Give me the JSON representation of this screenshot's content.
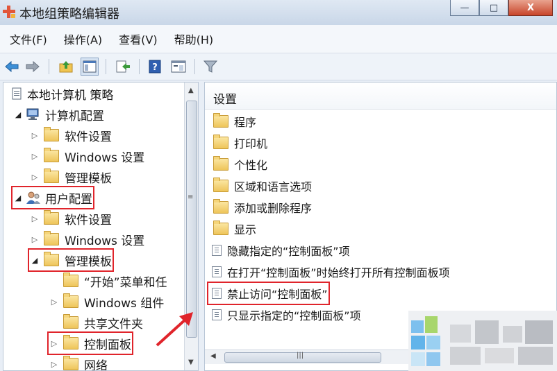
{
  "window": {
    "title": "本地组策略编辑器",
    "buttons": {
      "minimize": "—",
      "maximize": "□",
      "close": "X"
    }
  },
  "menu": [
    {
      "label": "文件(F)"
    },
    {
      "label": "操作(A)"
    },
    {
      "label": "查看(V)"
    },
    {
      "label": "帮助(H)"
    }
  ],
  "toolbar": [
    {
      "icon": "back-arrow-icon"
    },
    {
      "icon": "forward-arrow-icon"
    },
    {
      "icon": "up-folder-icon"
    },
    {
      "icon": "show-hide-tree-icon"
    },
    {
      "icon": "export-list-icon"
    },
    {
      "icon": "help-icon"
    },
    {
      "icon": "properties-icon"
    },
    {
      "icon": "filter-icon"
    }
  ],
  "tree": [
    {
      "label": "本地计算机 策略",
      "icon": "policy-doc-icon",
      "indent": 0,
      "expand": ""
    },
    {
      "label": "计算机配置",
      "icon": "computer-icon",
      "indent": 1,
      "expand": "open"
    },
    {
      "label": "软件设置",
      "icon": "folder-icon",
      "indent": 2,
      "expand": "closed"
    },
    {
      "label": "Windows 设置",
      "icon": "folder-icon",
      "indent": 2,
      "expand": "closed"
    },
    {
      "label": "管理模板",
      "icon": "folder-icon",
      "indent": 2,
      "expand": "closed"
    },
    {
      "label": "用户配置",
      "icon": "user-icon",
      "indent": 1,
      "expand": "open",
      "highlight": true
    },
    {
      "label": "软件设置",
      "icon": "folder-icon",
      "indent": 2,
      "expand": "closed"
    },
    {
      "label": "Windows 设置",
      "icon": "folder-icon",
      "indent": 2,
      "expand": "closed"
    },
    {
      "label": "管理模板",
      "icon": "folder-icon",
      "indent": 2,
      "expand": "open",
      "highlight": true
    },
    {
      "label": "“开始”菜单和任",
      "icon": "folder-icon",
      "indent": 3,
      "expand": ""
    },
    {
      "label": "Windows 组件",
      "icon": "folder-icon",
      "indent": 3,
      "expand": "closed"
    },
    {
      "label": "共享文件夹",
      "icon": "folder-icon",
      "indent": 3,
      "expand": ""
    },
    {
      "label": "控制面板",
      "icon": "folder-icon",
      "indent": 3,
      "expand": "closed",
      "highlight": true
    },
    {
      "label": "网络",
      "icon": "folder-icon",
      "indent": 3,
      "expand": "closed"
    }
  ],
  "settings": {
    "header": "设置",
    "items": [
      {
        "label": "程序",
        "type": "folder"
      },
      {
        "label": "打印机",
        "type": "folder"
      },
      {
        "label": "个性化",
        "type": "folder"
      },
      {
        "label": "区域和语言选项",
        "type": "folder"
      },
      {
        "label": "添加或删除程序",
        "type": "folder"
      },
      {
        "label": "显示",
        "type": "folder"
      },
      {
        "label": "隐藏指定的“控制面板”项",
        "type": "setting"
      },
      {
        "label": "在打开“控制面板”时始终打开所有控制面板项",
        "type": "setting"
      },
      {
        "label": "禁止访问“控制面板”",
        "type": "setting",
        "highlight": true
      },
      {
        "label": "只显示指定的“控制面板”项",
        "type": "setting"
      }
    ]
  },
  "colors": {
    "highlight": "#e0242b",
    "folder": "#eec55a",
    "titlebar": "#c9d7e8"
  }
}
